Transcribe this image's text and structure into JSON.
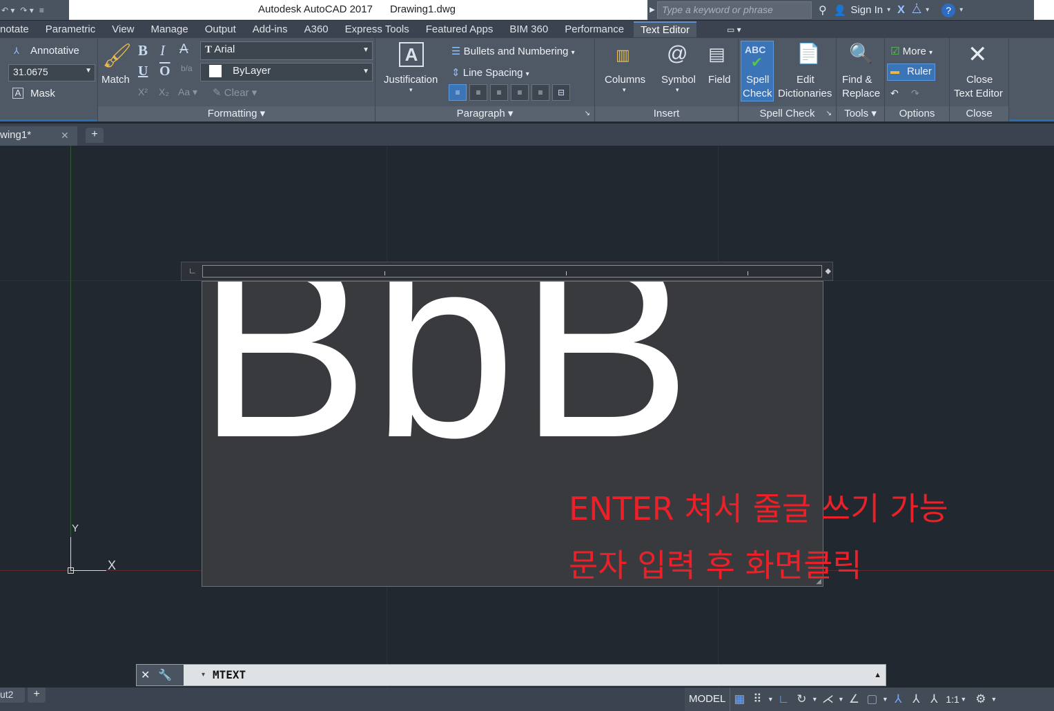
{
  "title_bar": {
    "app_title": "Autodesk AutoCAD 2017",
    "file_name": "Drawing1.dwg",
    "search_placeholder": "Type a keyword or phrase",
    "sign_in": "Sign In"
  },
  "ribbon_tabs": [
    "notate",
    "Parametric",
    "View",
    "Manage",
    "Output",
    "Add-ins",
    "A360",
    "Express Tools",
    "Featured Apps",
    "BIM 360",
    "Performance",
    "Text Editor"
  ],
  "active_tab": "Text Editor",
  "ribbon": {
    "style": {
      "annotative": "Annotative",
      "text_height": "31.0675",
      "mask": "Mask"
    },
    "formatting": {
      "title": "Formatting",
      "match": "Match",
      "bold": "B",
      "italic": "I",
      "underline": "U",
      "overline": "O",
      "font": "Arial",
      "color": "ByLayer",
      "clear": "Clear",
      "case": "Aa"
    },
    "paragraph": {
      "title": "Paragraph",
      "justification": "Justification",
      "bullets": "Bullets and Numbering",
      "line_spacing": "Line Spacing"
    },
    "insert": {
      "title": "Insert",
      "columns": "Columns",
      "symbol": "Symbol",
      "field": "Field"
    },
    "spell_check": {
      "title": "Spell Check",
      "spell_line1": "Spell",
      "spell_line2": "Check",
      "edit_line1": "Edit",
      "edit_line2": "Dictionaries",
      "abc": "ABC"
    },
    "tools": {
      "title": "Tools",
      "find_line1": "Find &",
      "find_line2": "Replace"
    },
    "options": {
      "title": "Options",
      "more": "More",
      "ruler": "Ruler"
    },
    "close": {
      "title": "Close",
      "close_line1": "Close",
      "close_line2": "Text Editor"
    }
  },
  "document_tab": "wing1*",
  "canvas": {
    "mtext_content": "BbB",
    "ucs_y": "Y",
    "ucs_x": "X"
  },
  "annotations": {
    "line1": "ENTER 쳐서 줄글 쓰기 가능",
    "line2": "문자 입력 후 화면클릭",
    "color": "#ec2028"
  },
  "command_line": {
    "text": "MTEXT"
  },
  "status_bar": {
    "layout_tab": "ut2",
    "model": "MODEL",
    "scale": "1:1"
  }
}
